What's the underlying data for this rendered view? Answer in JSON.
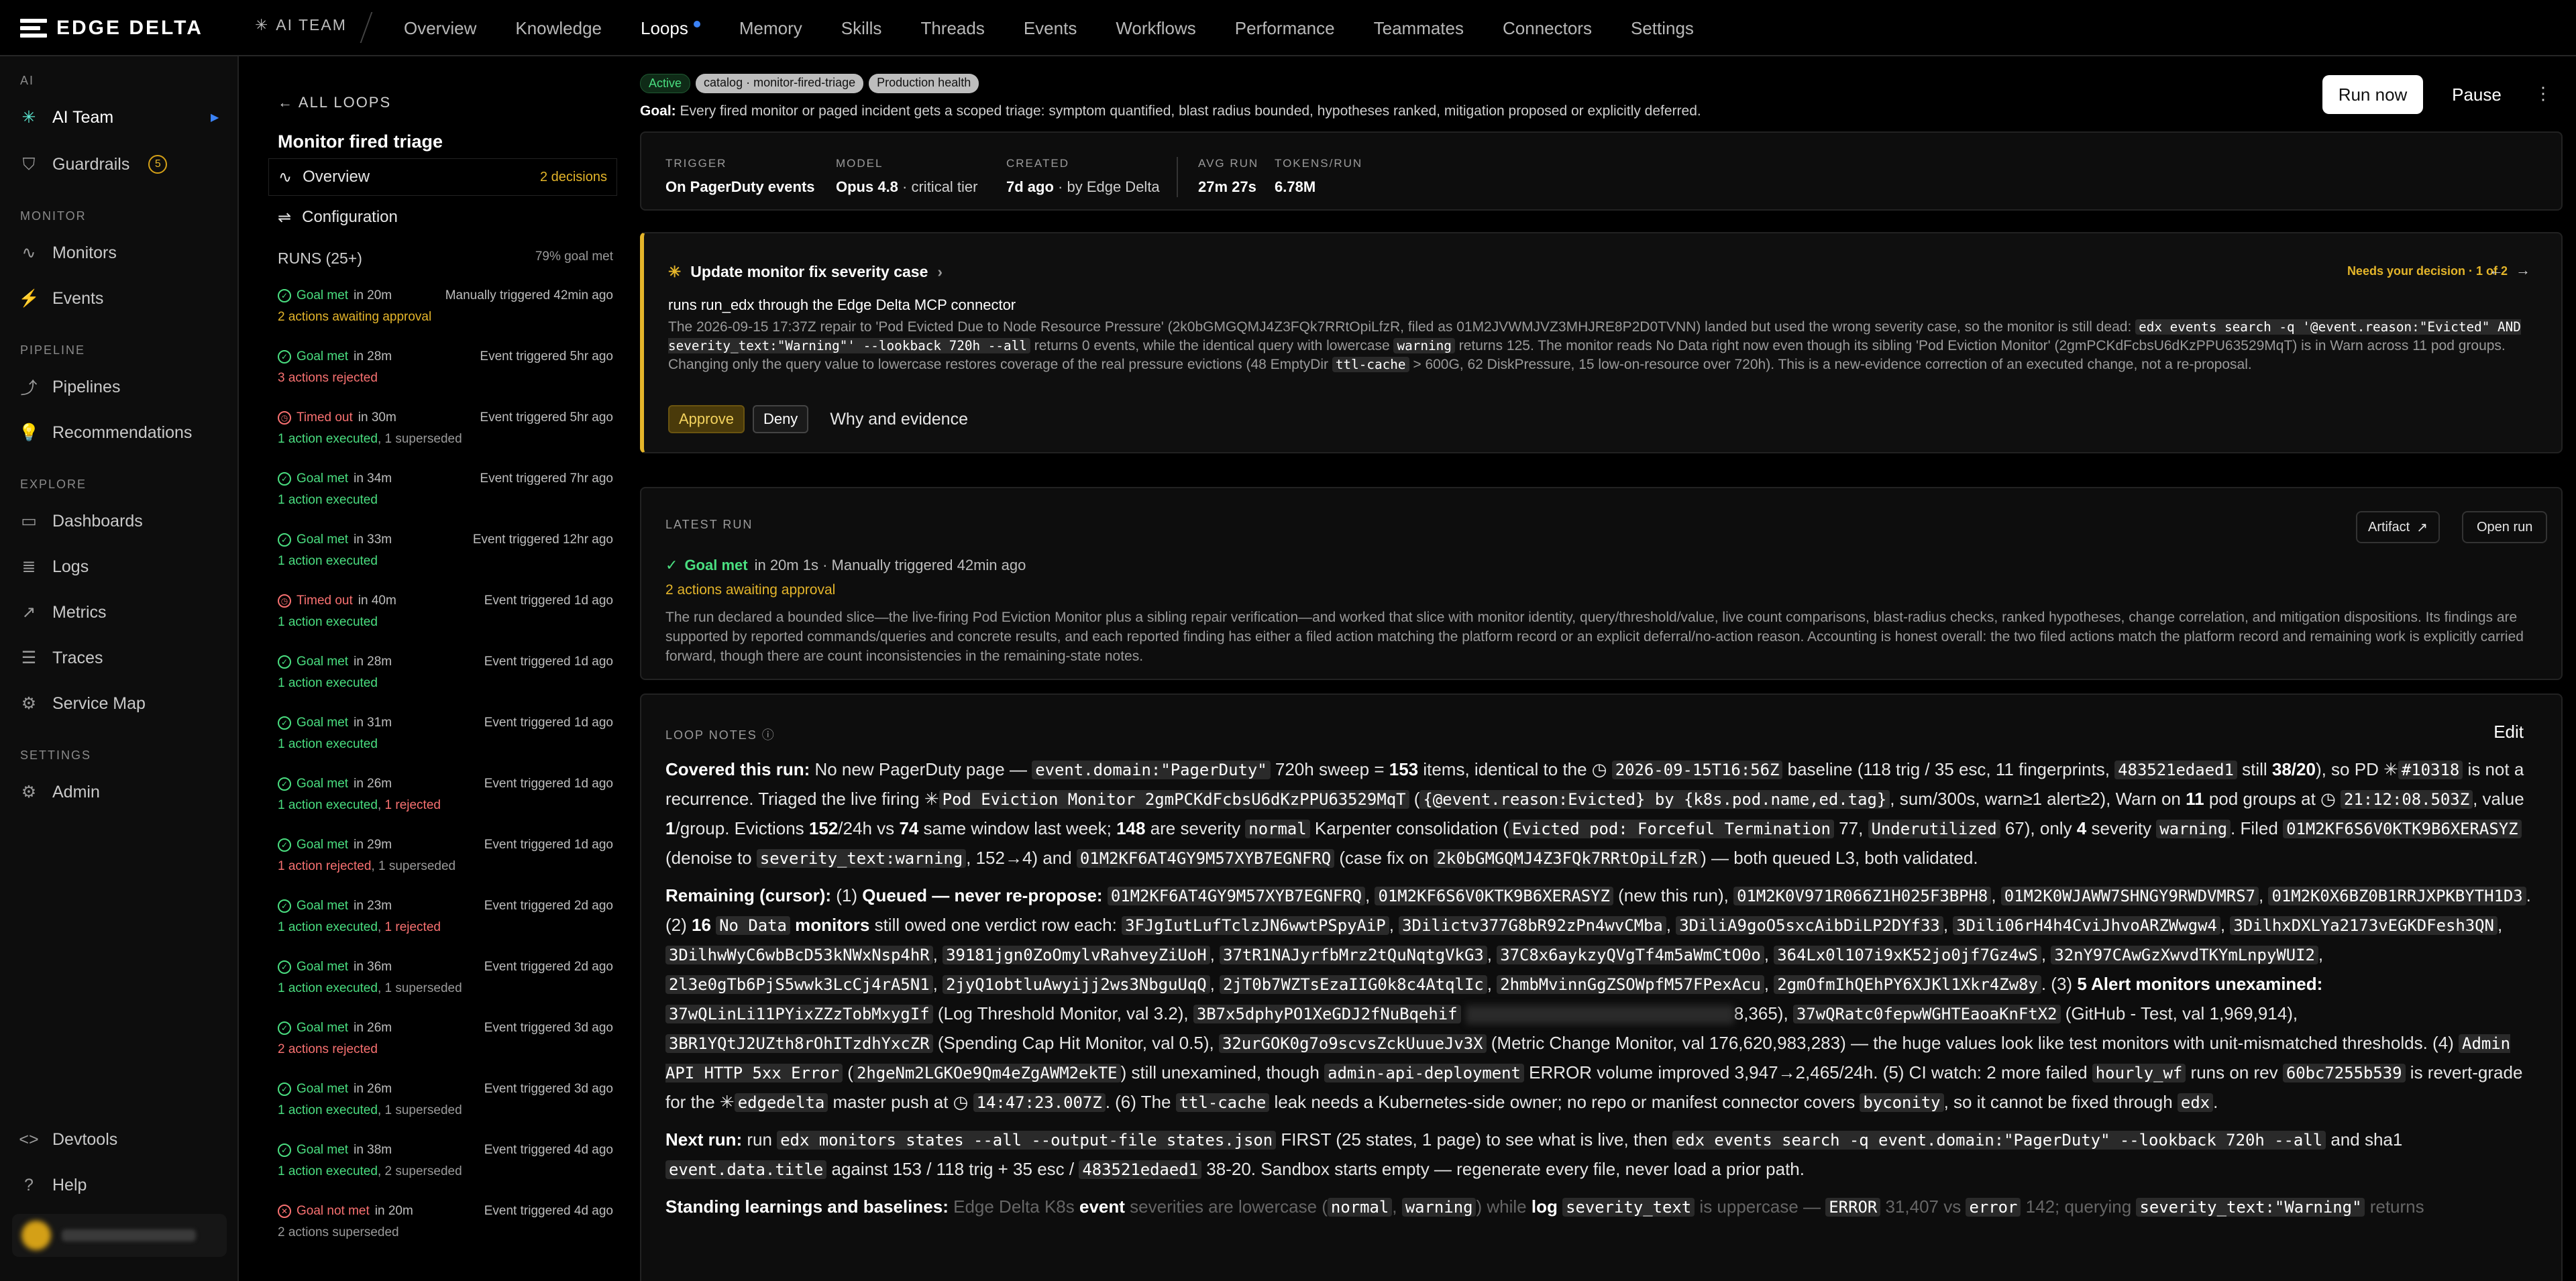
{
  "brand": {
    "logo_text": "EDGE DELTA",
    "team_label": "AI TEAM"
  },
  "nav": {
    "tabs": [
      "Overview",
      "Knowledge",
      "Loops",
      "Memory",
      "Skills",
      "Threads",
      "Events",
      "Workflows",
      "Performance",
      "Teammates",
      "Connectors",
      "Settings"
    ],
    "active": "Loops"
  },
  "sidebar": {
    "ai_label": "AI",
    "ai_team": "AI Team",
    "guardrails": "Guardrails",
    "guardrails_count": "5",
    "monitor_label": "MONITOR",
    "monitors": "Monitors",
    "events": "Events",
    "pipeline_label": "PIPELINE",
    "pipelines": "Pipelines",
    "recommendations": "Recommendations",
    "explore_label": "EXPLORE",
    "dashboards": "Dashboards",
    "logs": "Logs",
    "metrics": "Metrics",
    "traces": "Traces",
    "service_map": "Service Map",
    "settings_label": "SETTINGS",
    "admin": "Admin",
    "devtools": "Devtools",
    "help": "Help"
  },
  "loop": {
    "back": "ALL LOOPS",
    "title": "Monitor fired triage",
    "overview": "Overview",
    "overview_badge": "2 decisions",
    "configuration": "Configuration",
    "runs_title": "RUNS (25+)",
    "goal_rate": "79% goal met",
    "runs": [
      {
        "status": "Goal met",
        "dur": "in 20m",
        "trigger": "Manually triggered 42min ago",
        "detail": "2 actions awaiting approval",
        "s": "ok",
        "d": "amber"
      },
      {
        "status": "Goal met",
        "dur": "in 28m",
        "trigger": "Event triggered 5hr ago",
        "detail": "3 actions rejected",
        "s": "ok",
        "d": "red"
      },
      {
        "status": "Timed out",
        "dur": "in 30m",
        "trigger": "Event triggered 5hr ago",
        "detail": "1 action executed, 1 superseded",
        "s": "bad",
        "d": "mix"
      },
      {
        "status": "Goal met",
        "dur": "in 34m",
        "trigger": "Event triggered 7hr ago",
        "detail": "1 action executed",
        "s": "ok",
        "d": "green"
      },
      {
        "status": "Goal met",
        "dur": "in 33m",
        "trigger": "Event triggered 12hr ago",
        "detail": "1 action executed",
        "s": "ok",
        "d": "green"
      },
      {
        "status": "Timed out",
        "dur": "in 40m",
        "trigger": "Event triggered 1d ago",
        "detail": "1 action executed",
        "s": "bad",
        "d": "green"
      },
      {
        "status": "Goal met",
        "dur": "in 28m",
        "trigger": "Event triggered 1d ago",
        "detail": "1 action executed",
        "s": "ok",
        "d": "green"
      },
      {
        "status": "Goal met",
        "dur": "in 31m",
        "trigger": "Event triggered 1d ago",
        "detail": "1 action executed",
        "s": "ok",
        "d": "green"
      },
      {
        "status": "Goal met",
        "dur": "in 26m",
        "trigger": "Event triggered 1d ago",
        "detail": "1 action executed, 1 rejected",
        "s": "ok",
        "d": "mixr"
      },
      {
        "status": "Goal met",
        "dur": "in 29m",
        "trigger": "Event triggered 1d ago",
        "detail": "1 action rejected, 1 superseded",
        "s": "ok",
        "d": "rejsup"
      },
      {
        "status": "Goal met",
        "dur": "in 23m",
        "trigger": "Event triggered 2d ago",
        "detail": "1 action executed, 1 rejected",
        "s": "ok",
        "d": "mixr"
      },
      {
        "status": "Goal met",
        "dur": "in 36m",
        "trigger": "Event triggered 2d ago",
        "detail": "1 action executed, 1 superseded",
        "s": "ok",
        "d": "mix"
      },
      {
        "status": "Goal met",
        "dur": "in 26m",
        "trigger": "Event triggered 3d ago",
        "detail": "2 actions rejected",
        "s": "ok",
        "d": "red"
      },
      {
        "status": "Goal met",
        "dur": "in 26m",
        "trigger": "Event triggered 3d ago",
        "detail": "1 action executed, 1 superseded",
        "s": "ok",
        "d": "mix"
      },
      {
        "status": "Goal met",
        "dur": "in 38m",
        "trigger": "Event triggered 4d ago",
        "detail": "1 action executed, 2 superseded",
        "s": "ok",
        "d": "mix"
      },
      {
        "status": "Goal not met",
        "dur": "in 20m",
        "trigger": "Event triggered 4d ago",
        "detail": "2 actions superseded",
        "s": "fail",
        "d": "gray"
      }
    ]
  },
  "header": {
    "pill_status": "Active",
    "pill_catalog": "catalog · monitor-fired-triage",
    "pill_health": "Production health",
    "goal_label": "Goal:",
    "goal_text": "Every fired monitor or paged incident gets a scoped triage: symptom quantified, blast radius bounded, hypotheses ranked, mitigation proposed or explicitly deferred.",
    "run_now": "Run now",
    "pause": "Pause"
  },
  "meta": {
    "trigger_k": "TRIGGER",
    "trigger_v": "On PagerDuty events",
    "model_k": "MODEL",
    "model_v": "Opus 4.8",
    "model_sub": "· critical tier",
    "created_k": "CREATED",
    "created_v": "7d ago",
    "created_sub": "· by Edge Delta",
    "avg_k": "AVG RUN",
    "avg_v": "27m 27s",
    "tok_k": "TOKENS/RUN",
    "tok_v": "6.78M"
  },
  "decision": {
    "title": "Update monitor fix severity case",
    "need": "Needs your decision · 1 of 2",
    "sub": "runs run_edx through the Edge Delta MCP connector",
    "body_a": "The 2026-09-15 17:37Z repair to 'Pod Evicted Due to Node Resource Pressure' (2k0bGMGQMJ4Z3FQk7RRtOpiLfzR, filed as 01M2JVWMJVZ3MHJRE8P2D0TVNN) landed but used the wrong severity case, so the monitor is still dead:",
    "code_a": "edx events search -q '@event.reason:\"Evicted\" AND severity_text:\"Warning\"' --lookback 720h --all",
    "body_b": "returns 0 events, while the identical query with lowercase",
    "code_b": "warning",
    "body_c": "returns 125. The monitor reads No Data right now even though its sibling 'Pod Eviction Monitor' (2gmPCKdFcbsU6dKzPPU63529MqT) is in Warn across 11 pod groups. Changing only the query value to lowercase restores coverage of the real pressure evictions (48 EmptyDir",
    "code_c": "ttl-cache",
    "body_d": "> 600G, 62 DiskPressure, 15 low-on-resource over 720h). This is a new-evidence correction of an executed change, not a re-proposal.",
    "approve": "Approve",
    "deny": "Deny",
    "why": "Why and evidence"
  },
  "latest": {
    "label": "LATEST RUN",
    "artifact": "Artifact",
    "open_run": "Open run",
    "status": "Goal met",
    "line1": "in 20m 1s · Manually triggered 42min ago",
    "line2": "2 actions awaiting approval",
    "body": "The run declared a bounded slice—the live-firing Pod Eviction Monitor plus a sibling repair verification—and worked that slice with monitor identity, query/threshold/value, live count comparisons, blast-radius checks, ranked hypotheses, change correlation, and mitigation dispositions. Its findings are supported by reported commands/queries and concrete results, and each reported finding has either a filed action matching the platform record or an explicit deferral/no-action reason. Accounting is honest overall: the two filed actions match the platform record and remaining work is explicitly carried forward, though there are count inconsistencies in the remaining-state notes."
  },
  "notes": {
    "label": "LOOP NOTES",
    "edit": "Edit",
    "p1": [
      [
        "b",
        "Covered this run:"
      ],
      [
        "t",
        " No new PagerDuty page — "
      ],
      [
        "c",
        "event.domain:\"PagerDuty\""
      ],
      [
        "t",
        " 720h sweep = "
      ],
      [
        "b",
        "153"
      ],
      [
        "t",
        " items, identical to the ◷ "
      ],
      [
        "c",
        "2026-09-15T16:56Z"
      ],
      [
        "t",
        " baseline (118 trig / 35 esc, 11 fingerprints, "
      ],
      [
        "c",
        "483521edaed1"
      ],
      [
        "t",
        " still "
      ],
      [
        "b",
        "38/20"
      ],
      [
        "t",
        "), so PD ✳"
      ],
      [
        "c",
        "#10318"
      ],
      [
        "t",
        " is not a recurrence. Triaged the live firing ✳"
      ],
      [
        "c",
        "Pod Eviction Monitor 2gmPCKdFcbsU6dKzPPU63529MqT"
      ],
      [
        "t",
        " ("
      ],
      [
        "c",
        "{@event.reason:Evicted} by {k8s.pod.name,ed.tag}"
      ],
      [
        "t",
        ", sum/300s, warn≥1 alert≥2), Warn on "
      ],
      [
        "b",
        "11"
      ],
      [
        "t",
        " pod groups at ◷ "
      ],
      [
        "c",
        "21:12:08.503Z"
      ],
      [
        "t",
        ", value "
      ],
      [
        "b",
        "1"
      ],
      [
        "t",
        "/group. Evictions "
      ],
      [
        "b",
        "152"
      ],
      [
        "t",
        "/24h vs "
      ],
      [
        "b",
        "74"
      ],
      [
        "t",
        " same window last week; "
      ],
      [
        "b",
        "148"
      ],
      [
        "t",
        " are severity "
      ],
      [
        "c",
        "normal"
      ],
      [
        "t",
        " Karpenter consolidation ("
      ],
      [
        "c",
        "Evicted pod: Forceful Termination"
      ],
      [
        "t",
        " 77, "
      ],
      [
        "c",
        "Underutilized"
      ],
      [
        "t",
        " 67), only "
      ],
      [
        "b",
        "4"
      ],
      [
        "t",
        " severity "
      ],
      [
        "c",
        "warning"
      ],
      [
        "t",
        ". Filed "
      ],
      [
        "c",
        "01M2KF6S6V0KTK9B6XERASYZ"
      ],
      [
        "t",
        " (denoise to "
      ],
      [
        "c",
        "severity_text:warning"
      ],
      [
        "t",
        ", 152→4) and "
      ],
      [
        "c",
        "01M2KF6AT4GY9M57XYB7EGNFRQ"
      ],
      [
        "t",
        " (case fix on "
      ],
      [
        "c",
        "2k0bGMGQMJ4Z3FQk7RRtOpiLfzR"
      ],
      [
        "t",
        ") — both queued L3, both validated."
      ]
    ],
    "p2": [
      [
        "b",
        "Remaining (cursor):"
      ],
      [
        "t",
        " (1) "
      ],
      [
        "b",
        "Queued — never re-propose:"
      ],
      [
        "t",
        " "
      ],
      [
        "c",
        "01M2KF6AT4GY9M57XYB7EGNFRQ"
      ],
      [
        "t",
        ", "
      ],
      [
        "c",
        "01M2KF6S6V0KTK9B6XERASYZ"
      ],
      [
        "t",
        " (new this run), "
      ],
      [
        "c",
        "01M2K0V971R066Z1H025F3BPH8"
      ],
      [
        "t",
        ", "
      ],
      [
        "c",
        "01M2K0WJAWW7SHNGY9RWDVMRS7"
      ],
      [
        "t",
        ", "
      ],
      [
        "c",
        "01M2K0X6BZ0B1RRJXPKBYTH1D3"
      ],
      [
        "t",
        ". (2) "
      ],
      [
        "b",
        "16 "
      ],
      [
        "c",
        "No Data"
      ],
      [
        "b",
        " monitors"
      ],
      [
        "t",
        " still owed one verdict row each: "
      ],
      [
        "c",
        "3FJgIutLufTclzJN6wwtPSpyAiP"
      ],
      [
        "t",
        ", "
      ],
      [
        "c",
        "3Dilictv377G8bR92zPn4wvCMba"
      ],
      [
        "t",
        ", "
      ],
      [
        "c",
        "3DiliA9goO5sxcAibDiLP2DYf33"
      ],
      [
        "t",
        ", "
      ],
      [
        "c",
        "3Dili06rH4h4CviJhvoARZWwgw4"
      ],
      [
        "t",
        ", "
      ],
      [
        "c",
        "3DilhxDXLYa2173vEGKDFesh3QN"
      ],
      [
        "t",
        ", "
      ],
      [
        "c",
        "3DilhwWyC6wbBcD53kNWxNsp4hR"
      ],
      [
        "t",
        ", "
      ],
      [
        "c",
        "39181jgn0ZoOmylvRahveyZiUoH"
      ],
      [
        "t",
        ", "
      ],
      [
        "c",
        "37tR1NAJyrfbMrz2tQuNqtgVkG3"
      ],
      [
        "t",
        ", "
      ],
      [
        "c",
        "37C8x6aykzyQVgTf4m5aWmCtO0o"
      ],
      [
        "t",
        ", "
      ],
      [
        "c",
        "364Lx0l107i9xK52jo0jf7Gz4wS"
      ],
      [
        "t",
        ", "
      ],
      [
        "c",
        "32nY97CAwGzXwvdTKYmLnpyWUI2"
      ],
      [
        "t",
        ", "
      ],
      [
        "c",
        "2l3e0gTb6PjS5wwk3LcCj4rA5N1"
      ],
      [
        "t",
        ", "
      ],
      [
        "c",
        "2jyQ1obtluAwyijj2ws3NbguUqQ"
      ],
      [
        "t",
        ", "
      ],
      [
        "c",
        "2jT0b7WZTsEzaIIG0k8c4AtqlIc"
      ],
      [
        "t",
        ", "
      ],
      [
        "c",
        "2hmbMvinnGgZSOWpfM57FPexAcu"
      ],
      [
        "t",
        ", "
      ],
      [
        "c",
        "2gmOfmIhQEhPY6XJKl1Xkr4Zw8y"
      ],
      [
        "t",
        ". (3) "
      ],
      [
        "b",
        "5 Alert monitors unexamined:"
      ],
      [
        "t",
        " "
      ],
      [
        "c",
        "37wQLinLi11PYixZZzTobMxygIf"
      ],
      [
        "t",
        " (Log Threshold Monitor, val 3.2), "
      ],
      [
        "c",
        "3B7x5dphyPO1XeGDJ2fNuBqehif"
      ],
      [
        "t",
        " "
      ],
      [
        "x",
        ""
      ],
      [
        "t",
        "8,365), "
      ],
      [
        "c",
        "37wQRatc0fepwWGHTEaoaKnFtX2"
      ],
      [
        "t",
        " (GitHub - Test, val 1,969,914), "
      ],
      [
        "c",
        "3BR1YQtJ2UZth8rOhITzdhYxcZR"
      ],
      [
        "t",
        " (Spending Cap Hit Monitor, val 0.5), "
      ],
      [
        "c",
        "32urGOK0g7o9scvsZckUuueJv3X"
      ],
      [
        "t",
        " (Metric Change Monitor, val 176,620,983,283) — the huge values look like test monitors with unit-mismatched thresholds. (4) "
      ],
      [
        "c",
        "Admin API HTTP 5xx Error"
      ],
      [
        "t",
        " ("
      ],
      [
        "c",
        "2hgeNm2LGKOe9Qm4eZgAWM2ekTE"
      ],
      [
        "t",
        ") still unexamined, though "
      ],
      [
        "c",
        "admin-api-deployment"
      ],
      [
        "t",
        " ERROR volume improved 3,947→2,465/24h. (5) CI watch: 2 more failed "
      ],
      [
        "c",
        "hourly_wf"
      ],
      [
        "t",
        " runs on rev "
      ],
      [
        "c",
        "60bc7255b539"
      ],
      [
        "t",
        " is revert-grade for the ✳"
      ],
      [
        "c",
        "edgedelta"
      ],
      [
        "t",
        " master push at ◷ "
      ],
      [
        "c",
        "14:47:23.007Z"
      ],
      [
        "t",
        ". (6) The "
      ],
      [
        "c",
        "ttl-cache"
      ],
      [
        "t",
        " leak needs a Kubernetes-side owner; no repo or manifest connector covers "
      ],
      [
        "c",
        "byconity"
      ],
      [
        "t",
        ", so it cannot be fixed through "
      ],
      [
        "c",
        "edx"
      ],
      [
        "t",
        "."
      ]
    ],
    "p3": [
      [
        "b",
        "Next run:"
      ],
      [
        "t",
        " run "
      ],
      [
        "c",
        "edx monitors states --all --output-file states.json"
      ],
      [
        "t",
        " FIRST (25 states, 1 page) to see what is live, then "
      ],
      [
        "c",
        "edx events search -q event.domain:\"PagerDuty\" --lookback 720h --all"
      ],
      [
        "t",
        " and sha1 "
      ],
      [
        "c",
        "event.data.title"
      ],
      [
        "t",
        " against 153 / 118 trig + 35 esc / "
      ],
      [
        "c",
        "483521edaed1"
      ],
      [
        "t",
        " 38-20. Sandbox starts empty — regenerate every file, never load a prior path."
      ]
    ],
    "p4": [
      [
        "b",
        "Standing learnings and baselines:"
      ],
      [
        "t",
        " Edge Delta K8s "
      ],
      [
        "b",
        "event"
      ],
      [
        "t",
        " severities are lowercase ("
      ],
      [
        "c",
        "normal"
      ],
      [
        "t",
        ", "
      ],
      [
        "c",
        "warning"
      ],
      [
        "t",
        ") while "
      ],
      [
        "b",
        "log"
      ],
      [
        "t",
        " "
      ],
      [
        "c",
        "severity_text"
      ],
      [
        "t",
        " is uppercase — "
      ],
      [
        "c",
        "ERROR"
      ],
      [
        "t",
        " 31,407 vs "
      ],
      [
        "c",
        "error"
      ],
      [
        "t",
        " 142; querying "
      ],
      [
        "c",
        "severity_text:\"Warning\""
      ],
      [
        "t",
        " returns"
      ]
    ]
  }
}
